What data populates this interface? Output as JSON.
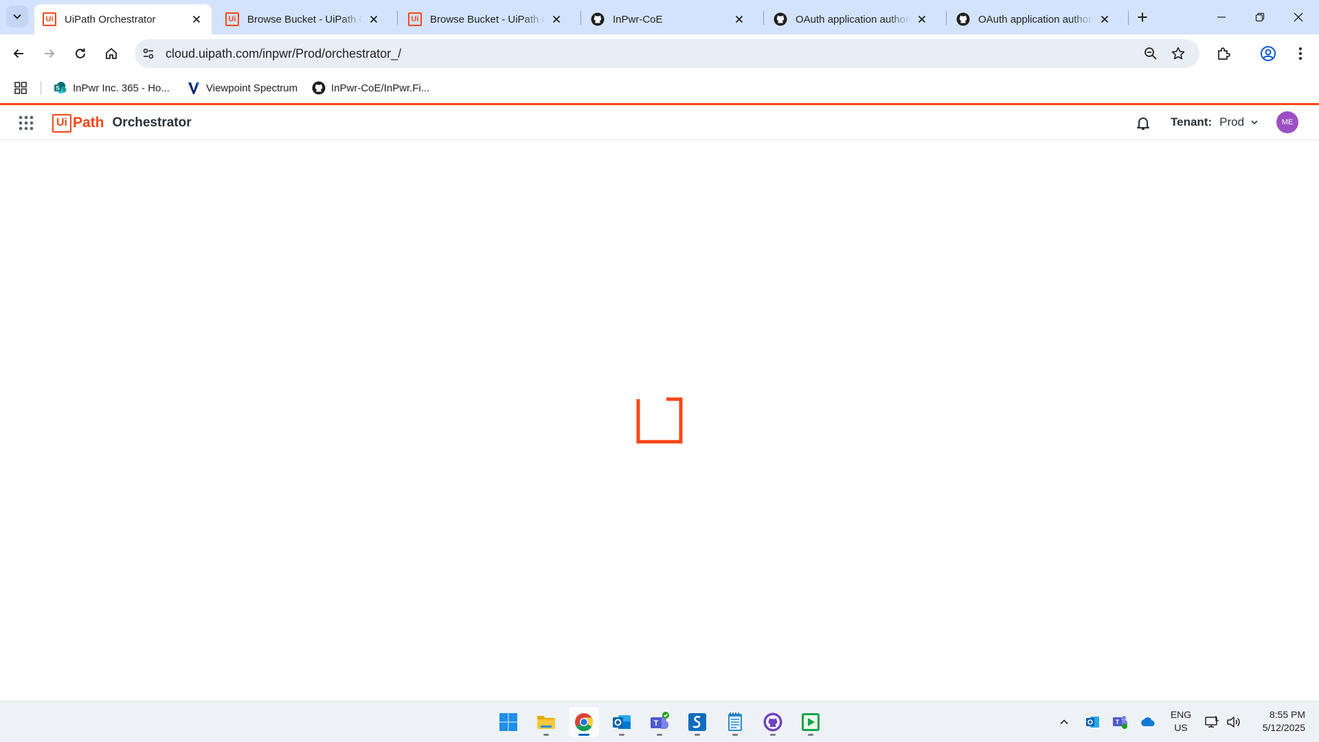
{
  "browser": {
    "tabs": [
      {
        "title": "UiPath Orchestrator",
        "icon": "uipath-favicon",
        "active": true
      },
      {
        "title": "Browse Bucket - UiPath Orchestrator",
        "icon": "uipath-favicon",
        "active": false
      },
      {
        "title": "Browse Bucket - UiPath Orchestrator",
        "icon": "uipath-favicon",
        "active": false
      },
      {
        "title": "InPwr-CoE",
        "icon": "github-icon",
        "active": false
      },
      {
        "title": "OAuth application authorization",
        "icon": "github-icon",
        "active": false
      },
      {
        "title": "OAuth application authorization",
        "icon": "github-icon",
        "active": false
      }
    ],
    "favicon_text": "Ui",
    "url": "cloud.uipath.com/inpwr/Prod/orchestrator_/",
    "bookmarks": [
      {
        "label": "InPwr Inc. 365 - Ho...",
        "icon": "sharepoint-icon"
      },
      {
        "label": "Viewpoint Spectrum",
        "icon": "viewpoint-icon"
      },
      {
        "label": "InPwr-CoE/InPwr.Fi...",
        "icon": "github-icon"
      }
    ]
  },
  "app": {
    "logo_ui": "Ui",
    "logo_path": "Path",
    "product_name": "Orchestrator",
    "tenant_label": "Tenant:",
    "tenant_value": "Prod",
    "avatar_initials": "ME",
    "brand_color": "#fa4616"
  },
  "taskbar": {
    "apps": [
      "windows-start",
      "file-explorer",
      "chrome",
      "outlook",
      "teams",
      "sharepoint",
      "notepad",
      "github-desktop",
      "media-app"
    ],
    "lang_line1": "ENG",
    "lang_line2": "US",
    "time": "8:55 PM",
    "date": "5/12/2025"
  }
}
